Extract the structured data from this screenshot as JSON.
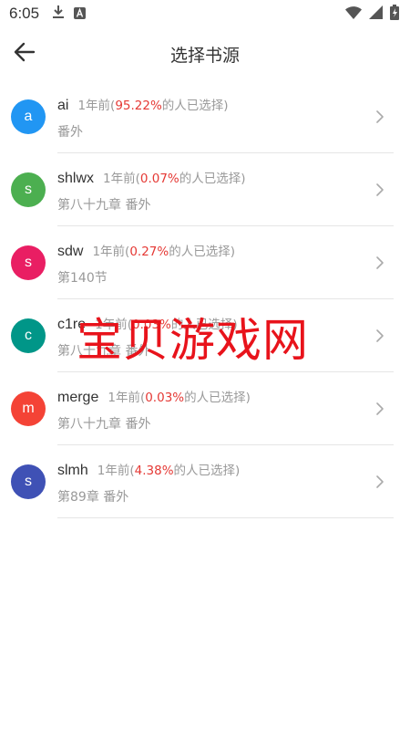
{
  "status_bar": {
    "time": "6:05",
    "icons_left": [
      "download-icon",
      "a-badge-icon"
    ],
    "icons_right": [
      "wifi-icon",
      "signal-icon",
      "battery-charging-icon"
    ]
  },
  "app_bar": {
    "back_icon": "arrow-left-icon",
    "title": "选择书源"
  },
  "sources": [
    {
      "avatar_letter": "a",
      "avatar_color": "#2196f3",
      "name": "ai",
      "time_prefix": "1年前(",
      "percent": "95.22%",
      "suffix": "的人已选择)",
      "chapter": "番外"
    },
    {
      "avatar_letter": "s",
      "avatar_color": "#4caf50",
      "name": "shlwx",
      "time_prefix": "1年前(",
      "percent": "0.07%",
      "suffix": "的人已选择)",
      "chapter": "第八十九章 番外"
    },
    {
      "avatar_letter": "s",
      "avatar_color": "#e91e63",
      "name": "sdw",
      "time_prefix": "1年前(",
      "percent": "0.27%",
      "suffix": "的人已选择)",
      "chapter": "第140节"
    },
    {
      "avatar_letter": "c",
      "avatar_color": "#009688",
      "name": "c1re",
      "time_prefix": "1年前(",
      "percent": "0.03%",
      "suffix": "的人已选择)",
      "chapter": "第八十九章 番外"
    },
    {
      "avatar_letter": "m",
      "avatar_color": "#f44336",
      "name": "merge",
      "time_prefix": "1年前(",
      "percent": "0.03%",
      "suffix": "的人已选择)",
      "chapter": "第八十九章 番外"
    },
    {
      "avatar_letter": "s",
      "avatar_color": "#3f51b5",
      "name": "slmh",
      "time_prefix": "1年前(",
      "percent": "4.38%",
      "suffix": "的人已选择)",
      "chapter": "第89章 番外"
    }
  ],
  "watermark": "宝贝游戏网",
  "colors": {
    "accent_red": "#e53935",
    "watermark_red": "#e8131b"
  }
}
